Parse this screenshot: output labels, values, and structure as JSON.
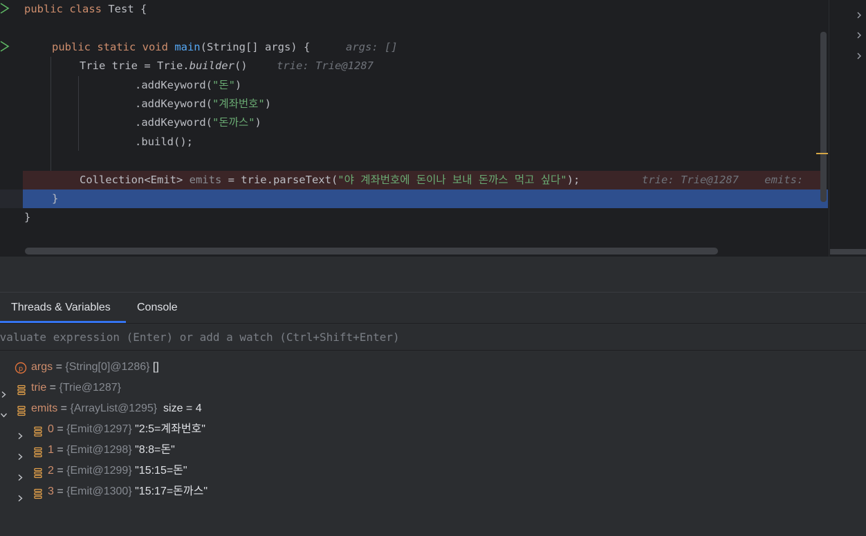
{
  "editor": {
    "lines": [
      {
        "segments": [
          {
            "c": "kw",
            "t": "public class "
          },
          {
            "c": "",
            "t": "Test {"
          }
        ]
      },
      {
        "segments": []
      },
      {
        "segments": [
          {
            "c": "kw",
            "t": "public static void "
          },
          {
            "c": "fn",
            "t": "main"
          },
          {
            "c": "",
            "t": "(String[] args) {"
          }
        ],
        "hint": "args: []"
      },
      {
        "segments": [
          {
            "c": "",
            "t": "Trie trie = Trie."
          },
          {
            "c": "it",
            "t": "builder"
          },
          {
            "c": "",
            "t": "()"
          }
        ],
        "hint": "trie: Trie@1287"
      },
      {
        "segments": [
          {
            "c": "",
            "t": ".addKeyword("
          },
          {
            "c": "str",
            "t": "\"돈\""
          },
          {
            "c": "",
            "t": ")"
          }
        ]
      },
      {
        "segments": [
          {
            "c": "",
            "t": ".addKeyword("
          },
          {
            "c": "str",
            "t": "\"계좌번호\""
          },
          {
            "c": "",
            "t": ")"
          }
        ]
      },
      {
        "segments": [
          {
            "c": "",
            "t": ".addKeyword("
          },
          {
            "c": "str",
            "t": "\"돈까스\""
          },
          {
            "c": "",
            "t": ")"
          }
        ]
      },
      {
        "segments": [
          {
            "c": "",
            "t": ".build();"
          }
        ]
      },
      {
        "segments": []
      },
      {
        "segments": [
          {
            "c": "",
            "t": "Collection<Emit> "
          },
          {
            "c": "var-dim",
            "t": "emits"
          },
          {
            "c": "",
            "t": " = trie.parseText("
          },
          {
            "c": "str",
            "t": "\"야 계좌번호에 돈이나 보내 돈까스 먹고 싶다\""
          },
          {
            "c": "",
            "t": ");"
          }
        ],
        "hint": "trie: Trie@1287    emits: "
      },
      {
        "segments": [
          {
            "c": "",
            "t": "}"
          }
        ]
      },
      {
        "segments": [
          {
            "c": "",
            "t": "}"
          }
        ]
      }
    ]
  },
  "debug": {
    "tabs": [
      {
        "label": "Threads & Variables"
      },
      {
        "label": "Console"
      }
    ],
    "eval_placeholder": "Evaluate expression (Enter) or add a watch (Ctrl+Shift+Enter)",
    "variables": [
      {
        "name": "args",
        "type": "{String[0]@1286}",
        "value": "[]",
        "icon": "parameter-icon",
        "expandable": false,
        "depth": 0
      },
      {
        "name": "trie",
        "type": "{Trie@1287}",
        "value": "",
        "icon": "field-icon",
        "expandable": true,
        "expanded": false,
        "depth": 0
      },
      {
        "name": "emits",
        "type": "{ArrayList@1295}",
        "value": "size = 4",
        "icon": "field-icon",
        "expandable": true,
        "expanded": true,
        "depth": 0
      },
      {
        "name": "0",
        "type": "{Emit@1297}",
        "value": "\"2:5=계좌번호\"",
        "icon": "field-icon",
        "expandable": true,
        "expanded": false,
        "depth": 1
      },
      {
        "name": "1",
        "type": "{Emit@1298}",
        "value": "\"8:8=돈\"",
        "icon": "field-icon",
        "expandable": true,
        "expanded": false,
        "depth": 1
      },
      {
        "name": "2",
        "type": "{Emit@1299}",
        "value": "\"15:15=돈\"",
        "icon": "field-icon",
        "expandable": true,
        "expanded": false,
        "depth": 1
      },
      {
        "name": "3",
        "type": "{Emit@1300}",
        "value": "\"15:17=돈까스\"",
        "icon": "field-icon",
        "expandable": true,
        "expanded": false,
        "depth": 1
      }
    ]
  },
  "colors": {
    "accent": "#3574f0",
    "exec_line": "#2e4f8e",
    "breakpoint_line": "#3b2527",
    "string": "#6aab73",
    "keyword": "#cf8e6d",
    "function": "#56a8f5"
  }
}
